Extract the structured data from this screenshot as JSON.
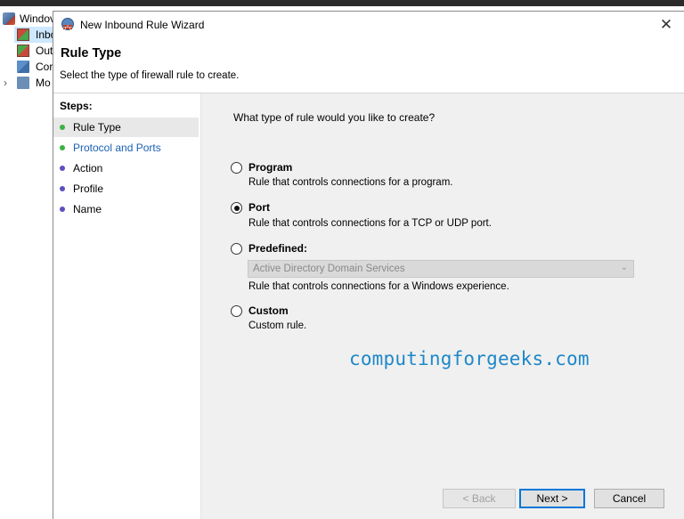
{
  "background_window": {
    "tree": [
      {
        "label": "Windov",
        "icon": "firewall-icon"
      },
      {
        "label": "Inbo",
        "icon": "inbound-rules-icon",
        "selected": true
      },
      {
        "label": "Out",
        "icon": "outbound-rules-icon"
      },
      {
        "label": "Cor",
        "icon": "connection-security-icon"
      },
      {
        "label": "Mo",
        "icon": "monitoring-icon"
      }
    ]
  },
  "wizard": {
    "title": "New Inbound Rule Wizard",
    "close_glyph": "✕",
    "header": {
      "title": "Rule Type",
      "subtitle": "Select the type of firewall rule to create."
    },
    "steps_heading": "Steps:",
    "steps": [
      {
        "label": "Rule Type",
        "status": "current",
        "dot_color": "#3cb043"
      },
      {
        "label": "Protocol and Ports",
        "status": "next",
        "dot_color": "#3cb043"
      },
      {
        "label": "Action",
        "status": "pending",
        "dot_color": "#5b4fc0"
      },
      {
        "label": "Profile",
        "status": "pending",
        "dot_color": "#5b4fc0"
      },
      {
        "label": "Name",
        "status": "pending",
        "dot_color": "#5b4fc0"
      }
    ],
    "question": "What type of rule would you like to create?",
    "options": [
      {
        "label": "Program",
        "desc": "Rule that controls connections for a program.",
        "checked": false
      },
      {
        "label": "Port",
        "desc": "Rule that controls connections for a TCP or UDP port.",
        "checked": true
      },
      {
        "label": "Predefined:",
        "desc": "Rule that controls connections for a Windows experience.",
        "checked": false,
        "select_value": "Active Directory Domain Services"
      },
      {
        "label": "Custom",
        "desc": "Custom rule.",
        "checked": false
      }
    ],
    "watermark": "computingforgeeks.com",
    "buttons": {
      "back": "< Back",
      "next": "Next >",
      "cancel": "Cancel"
    }
  }
}
